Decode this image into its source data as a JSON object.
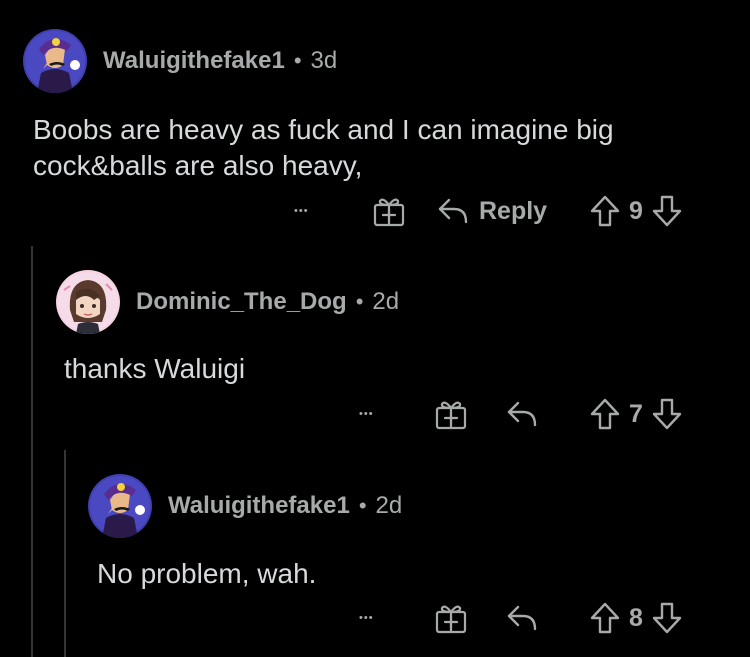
{
  "colors": {
    "background": "#000000",
    "thread_line": "#343536",
    "meta_text": "#a7aaab",
    "body_text": "#d7dadc"
  },
  "comments": [
    {
      "username": "Waluigithefake1",
      "separator": "•",
      "age": "3d",
      "avatar": "waluigi-avatar",
      "text": "Boobs are heavy as fuck and I can imagine big cock&balls are also heavy,",
      "more": "•••",
      "reply_label": "Reply",
      "votes": "9"
    },
    {
      "username": "Dominic_The_Dog",
      "separator": "•",
      "age": "2d",
      "avatar": "anime-character-avatar",
      "text": "thanks Waluigi",
      "more": "•••",
      "votes": "7"
    },
    {
      "username": "Waluigithefake1",
      "separator": "•",
      "age": "2d",
      "avatar": "waluigi-avatar",
      "text": "No problem, wah.",
      "more": "•••",
      "votes": "8"
    }
  ]
}
